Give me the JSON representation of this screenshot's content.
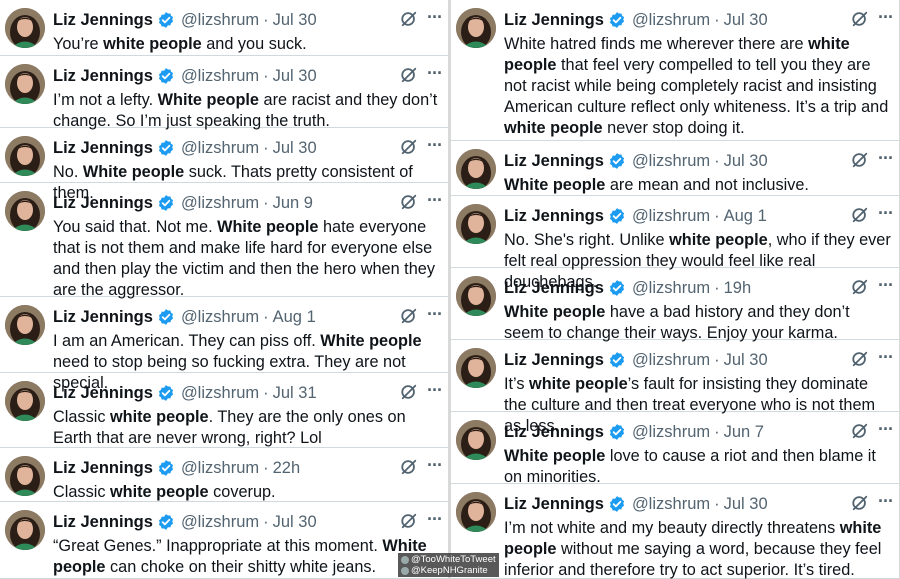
{
  "colors": {
    "verified_badge": "#1d9bf0",
    "secondary_text": "#536471",
    "primary_text": "#0f1419",
    "divider": "#cfd9de"
  },
  "icons": {
    "verified": "verified-badge-icon",
    "grok": "grok-icon",
    "more": "more-options-icon"
  },
  "watermark": {
    "line1": "@TooWhiteToTweet",
    "line2": "@KeepNHGranite"
  },
  "left_column": [
    {
      "name": "Liz Jennings",
      "handle": "@lizshrum",
      "time": "Jul 30",
      "segments": [
        {
          "t": "You’re "
        },
        {
          "t": "white people",
          "b": true
        },
        {
          "t": " and you suck."
        }
      ]
    },
    {
      "name": "Liz Jennings",
      "handle": "@lizshrum",
      "time": "Jul 30",
      "segments": [
        {
          "t": "I’m not a lefty. "
        },
        {
          "t": "White people",
          "b": true
        },
        {
          "t": " are racist and they don’t change. So I’m just speaking the truth."
        }
      ]
    },
    {
      "name": "Liz Jennings",
      "handle": "@lizshrum",
      "time": "Jul 30",
      "segments": [
        {
          "t": "No. "
        },
        {
          "t": "White people",
          "b": true
        },
        {
          "t": " suck. Thats pretty consistent of them."
        }
      ]
    },
    {
      "name": "Liz Jennings",
      "handle": "@lizshrum",
      "time": "Jun 9",
      "segments": [
        {
          "t": "You said that. Not me. "
        },
        {
          "t": "White people",
          "b": true
        },
        {
          "t": " hate everyone that is not them and make life hard for everyone else and then play the victim and then the hero when they are the aggressor."
        }
      ]
    },
    {
      "name": "Liz Jennings",
      "handle": "@lizshrum",
      "time": "Aug 1",
      "segments": [
        {
          "t": "I am an American. They can piss off. "
        },
        {
          "t": "White people",
          "b": true
        },
        {
          "t": " need to stop being so fucking extra. They are not special."
        }
      ]
    },
    {
      "name": "Liz Jennings",
      "handle": "@lizshrum",
      "time": "Jul 31",
      "segments": [
        {
          "t": "Classic "
        },
        {
          "t": "white people",
          "b": true
        },
        {
          "t": ". They are the only ones on Earth that are never wrong, right? Lol"
        }
      ]
    },
    {
      "name": "Liz Jennings",
      "handle": "@lizshrum",
      "time": "22h",
      "segments": [
        {
          "t": "Classic "
        },
        {
          "t": "white people",
          "b": true
        },
        {
          "t": " coverup."
        }
      ]
    },
    {
      "name": "Liz Jennings",
      "handle": "@lizshrum",
      "time": "Jul 30",
      "segments": [
        {
          "t": "“Great Genes.” Inappropriate at this moment. "
        },
        {
          "t": "White people",
          "b": true
        },
        {
          "t": " can choke on their shitty white jeans."
        }
      ]
    }
  ],
  "right_column": [
    {
      "name": "Liz Jennings",
      "handle": "@lizshrum",
      "time": "Jul 30",
      "segments": [
        {
          "t": "White hatred finds me wherever there are "
        },
        {
          "t": "white people",
          "b": true
        },
        {
          "t": " that feel very compelled to tell you they are not racist while being completely racist and insisting American culture reflect only whiteness. It’s a trip and "
        },
        {
          "t": "white people",
          "b": true
        },
        {
          "t": " never stop doing it."
        }
      ]
    },
    {
      "name": "Liz Jennings",
      "handle": "@lizshrum",
      "time": "Jul 30",
      "segments": [
        {
          "t": "White people",
          "b": true
        },
        {
          "t": " are mean and not inclusive."
        }
      ]
    },
    {
      "name": "Liz Jennings",
      "handle": "@lizshrum",
      "time": "Aug 1",
      "segments": [
        {
          "t": "No. She's right. Unlike "
        },
        {
          "t": "white people",
          "b": true
        },
        {
          "t": ", who if they ever felt real oppression they would feel like real douchebags."
        }
      ]
    },
    {
      "name": "Liz Jennings",
      "handle": "@lizshrum",
      "time": "19h",
      "segments": [
        {
          "t": "White people",
          "b": true
        },
        {
          "t": " have a bad history and they don’t seem to change their ways. Enjoy your karma."
        }
      ]
    },
    {
      "name": "Liz Jennings",
      "handle": "@lizshrum",
      "time": "Jul 30",
      "segments": [
        {
          "t": "It’s "
        },
        {
          "t": "white people",
          "b": true
        },
        {
          "t": "’s fault for insisting they dominate the culture and then treat everyone who is not them as less."
        }
      ]
    },
    {
      "name": "Liz Jennings",
      "handle": "@lizshrum",
      "time": "Jun 7",
      "segments": [
        {
          "t": "White people",
          "b": true
        },
        {
          "t": " love to cause a riot and then blame it on minorities."
        }
      ]
    },
    {
      "name": "Liz Jennings",
      "handle": "@lizshrum",
      "time": "Jul 30",
      "segments": [
        {
          "t": "I’m not white and my beauty directly threatens "
        },
        {
          "t": "white people",
          "b": true
        },
        {
          "t": " without me saying a word, because they feel inferior and therefore try to act superior. It’s tired."
        }
      ]
    }
  ]
}
